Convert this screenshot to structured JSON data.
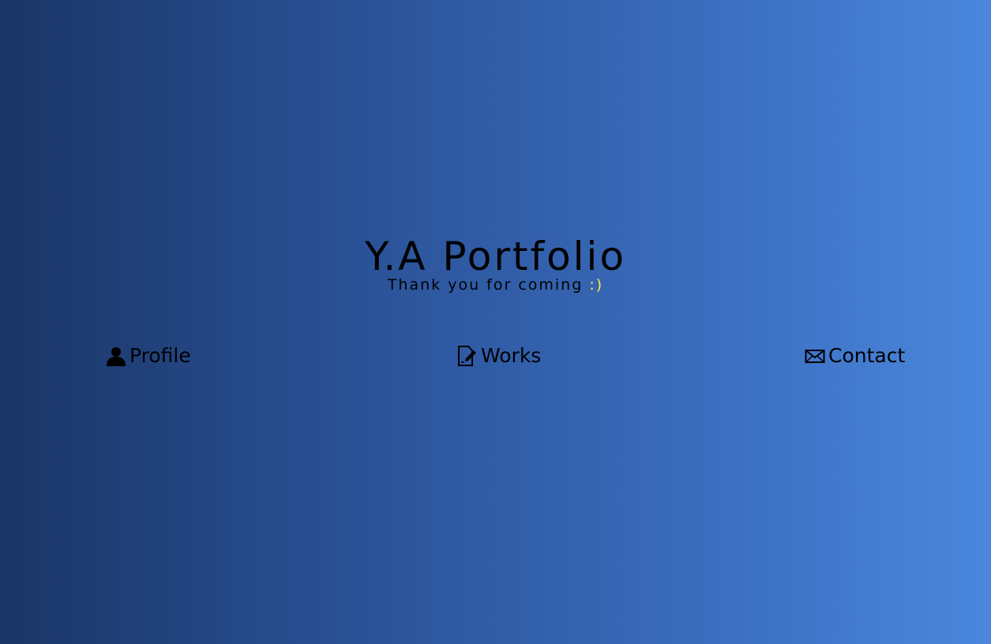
{
  "hero": {
    "title": "Y.A Portfolio",
    "subtitle": "Thank you for coming ",
    "smiley": ":)",
    "smiley_color": "#ffe94a"
  },
  "nav": {
    "items": [
      {
        "label": "Profile",
        "icon": "user-icon"
      },
      {
        "label": "Works",
        "icon": "document-edit-icon"
      },
      {
        "label": "Contact",
        "icon": "envelope-icon"
      }
    ]
  },
  "colors": {
    "gradient_left": "#1a3566",
    "gradient_right": "#4a87dd",
    "text": "#000000"
  }
}
